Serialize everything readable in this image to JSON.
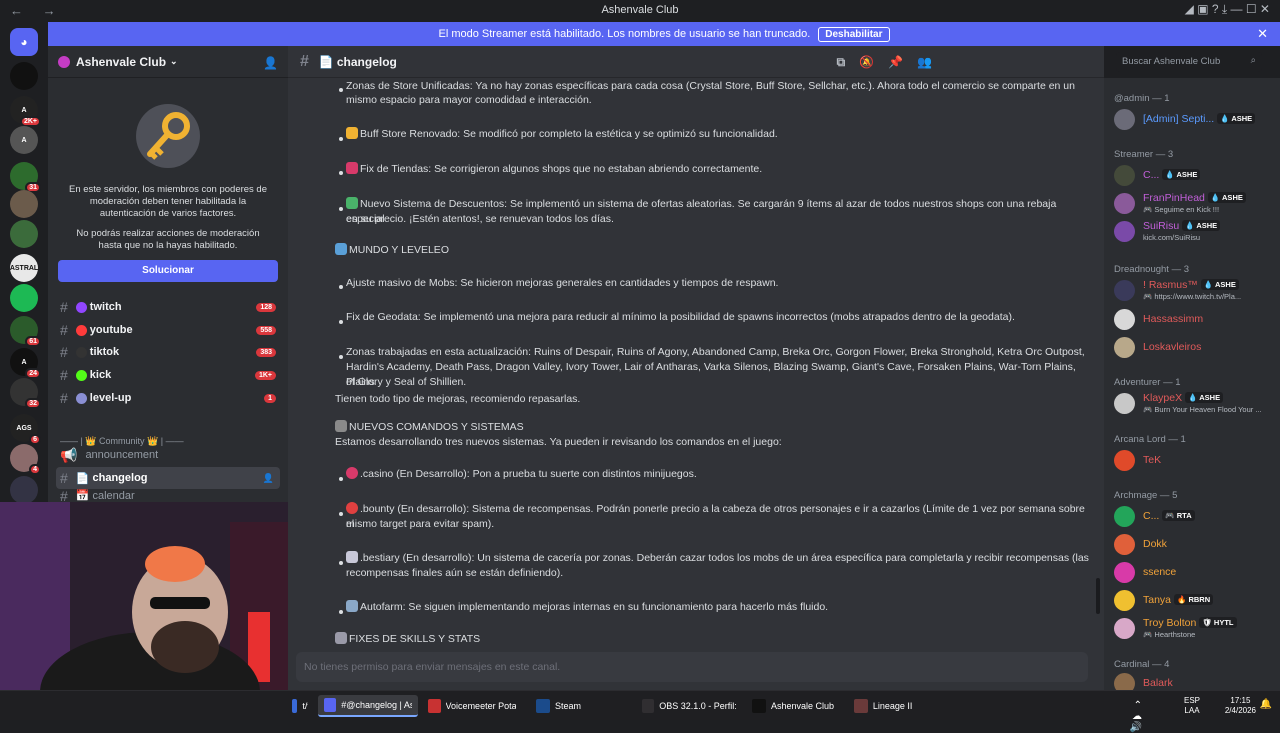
{
  "window": {
    "title": "Ashenvale Club",
    "nav_arrows": "← →",
    "controls": "◢ ▣ ? ⤓ — ☐ ✕"
  },
  "banner": {
    "text": "El modo Streamer está habilitado. Los nombres de usuario se han truncado.",
    "button": "Deshabilitar",
    "close": "✕"
  },
  "guilds": [
    {
      "label": "",
      "color": "#5865f2",
      "badge": ""
    },
    {
      "label": "",
      "color": "#111111",
      "badge": ""
    },
    {
      "label": "A",
      "color": "#222222",
      "badge": "2K+"
    },
    {
      "label": "A",
      "color": "#555555",
      "badge": ""
    },
    {
      "label": "",
      "color": "#2d6b2d",
      "badge": "31"
    },
    {
      "label": "",
      "color": "#6b5b4b",
      "badge": ""
    },
    {
      "label": "",
      "color": "#3b6b3b",
      "badge": ""
    },
    {
      "label": "ASTRAL",
      "color": "#e8e8e8",
      "badge": ""
    },
    {
      "label": "",
      "color": "#1db954",
      "badge": ""
    },
    {
      "label": "",
      "color": "#2b5b2b",
      "badge": "61"
    },
    {
      "label": "A",
      "color": "#111111",
      "badge": "24"
    },
    {
      "label": "",
      "color": "#333333",
      "badge": "32"
    },
    {
      "label": "AGS",
      "color": "#222222",
      "badge": "6"
    },
    {
      "label": "",
      "color": "#8b6b6b",
      "badge": "4"
    },
    {
      "label": "",
      "color": "#333344",
      "badge": ""
    }
  ],
  "sidebar": {
    "server_name": "Ashenvale Club",
    "mod_text_1": "En este servidor, los miembros con poderes de moderación deben tener habilitada la autenticación de varios factores.",
    "mod_text_2": "No podrás realizar acciones de moderación hasta que no la hayas habilitado.",
    "solve_button": "Solucionar",
    "channels": [
      {
        "name": "twitch",
        "dot": "#9146ff",
        "badge": "128"
      },
      {
        "name": "youtube",
        "dot": "#ff3b3b",
        "badge": "558"
      },
      {
        "name": "tiktok",
        "dot": "#333333",
        "badge": "383"
      },
      {
        "name": "kick",
        "dot": "#53fc18",
        "badge": "1K+"
      },
      {
        "name": "level-up",
        "dot": "#8a8fd4",
        "badge": "1"
      }
    ],
    "category": "—— | 👑 Community 👑 | ——",
    "announcement": "announcement",
    "changelog": "changelog",
    "calendar": "calendar"
  },
  "channel_header": {
    "name": "changelog",
    "search_placeholder": "Buscar Ashenvale Club"
  },
  "messages": {
    "m1": "Zonas de Store Unificadas: Ya no hay zonas específicas para cada cosa (Crystal Store, Buff Store, Sellchar, etc.). Ahora todo el comercio se comparte en un",
    "m1b": "mismo espacio para mayor comodidad e interacción.",
    "m2": "Buff Store Renovado: Se modificó por completo la estética y se optimizó su funcionalidad.",
    "m3": "Fix de Tiendas: Se corrigieron algunos shops que no estaban abriendo correctamente.",
    "m4": "Nuevo Sistema de Descuentos: Se implementó un sistema de ofertas aleatorias. Se cargarán 9 ítems al azar de todos nuestros shops con una rebaja especial",
    "m4b": "en su precio. ¡Estén atentos!, se renuevan todos los días.",
    "h1": "MUNDO Y LEVELEO",
    "m5": "Ajuste masivo de Mobs: Se hicieron mejoras generales en cantidades y tiempos de respawn.",
    "m6": "Fix de Geodata: Se implementó una mejora para reducir al mínimo la posibilidad de spawns incorrectos (mobs atrapados dentro de la geodata).",
    "m7": "Zonas trabajadas en esta actualización: Ruins of Despair, Ruins of Agony, Abandoned Camp, Breka Orc, Gorgon Flower, Breka Stronghold, Ketra Orc Outpost,",
    "m7b": "Hardin's Academy, Death Pass, Dragon Valley, Ivory Tower, Lair of Antharas, Varka Silenos, Blazing Swamp, Giant's Cave, Forsaken Plains, War-Torn Plains, Plains",
    "m7c": "of Glory y Seal of Shillien.",
    "m8": "Tienen todo tipo de mejoras, recomiendo repasarlas.",
    "h2": "NUEVOS COMANDOS Y SISTEMAS",
    "m9": "Estamos desarrollando tres nuevos sistemas. Ya pueden ir revisando los comandos en el juego:",
    "m10": ".casino (En Desarrollo): Pon a prueba tu suerte con distintos minijuegos.",
    "m11": ".bounty (En desarrollo): Sistema de recompensas. Podrán ponerle precio a la cabeza de otros personajes e ir a cazarlos (Límite de 1 vez por semana sobre el",
    "m11b": "mismo target para evitar spam).",
    "m12": ".bestiary (En desarrollo): Un sistema de cacería por zonas. Deberán cazar todos los mobs de un área específica para completarla y recibir recompensas (las",
    "m12b": "recompensas finales aún se están definiendo).",
    "m13": "Autofarm: Se siguen implementando mejoras internas en su funcionamiento para hacerlo más fluido.",
    "h3": "FIXES DE SKILLS Y STATS",
    "input_placeholder": "No tienes permiso para enviar mensajes en este canal."
  },
  "members": {
    "groups": [
      {
        "label": "@admin — 1"
      },
      {
        "label": "Streamer — 3"
      },
      {
        "label": "Dreadnought — 3"
      },
      {
        "label": "Adventurer — 1"
      },
      {
        "label": "Arcana Lord — 1"
      },
      {
        "label": "Archmage — 5"
      },
      {
        "label": "Cardinal — 4"
      }
    ],
    "list": [
      {
        "name": "[Admin] Septi...",
        "color": "#5b9bff",
        "tag": "💧 ASHE",
        "status": "",
        "av": "#6b6b78"
      },
      {
        "name": "C...",
        "color": "#c15fd8",
        "tag": "💧 ASHE",
        "status": "",
        "av": "#444a3a"
      },
      {
        "name": "FranPinHead",
        "color": "#c15fd8",
        "tag": "💧 ASHE",
        "status": "🎮 Seguime en Kick !!!",
        "av": "#8a5a9a"
      },
      {
        "name": "SuiRisu",
        "color": "#c15fd8",
        "tag": "💧 ASHE",
        "status": "kick.com/SuiRisu",
        "av": "#7a4aa8"
      },
      {
        "name": "! Rasmus™",
        "color": "#e05a5a",
        "tag": "💧 ASHE",
        "status": "🎮 https://www.twitch.tv/Pla...",
        "av": "#3a3a5a"
      },
      {
        "name": "Hassassimm",
        "color": "#e05a5a",
        "tag": "",
        "status": "",
        "av": "#d8d8d8"
      },
      {
        "name": "Loskavleiros",
        "color": "#e05a5a",
        "tag": "",
        "status": "",
        "av": "#b8a88a"
      },
      {
        "name": "KlaypeX",
        "color": "#e05a5a",
        "tag": "💧 ASHE",
        "status": "🎮 Burn Your Heaven Flood Your ...",
        "av": "#c8c8c8"
      },
      {
        "name": "TeK",
        "color": "#e05a5a",
        "tag": "",
        "status": "",
        "av": "#e04a2a"
      },
      {
        "name": "C...",
        "color": "#f0a23a",
        "tag": "🎮 RTA",
        "status": "",
        "av": "#23a55a"
      },
      {
        "name": "Dokk",
        "color": "#f0a23a",
        "tag": "",
        "status": "",
        "av": "#e0603a"
      },
      {
        "name": "ssence",
        "color": "#f0a23a",
        "tag": "",
        "status": "",
        "av": "#d83aa8"
      },
      {
        "name": "Tanya",
        "color": "#f0a23a",
        "tag": "🔥 RBRN",
        "status": "",
        "av": "#f0c030"
      },
      {
        "name": "Troy Bolton",
        "color": "#f0a23a",
        "tag": "🛡 HYTL",
        "status": "🎮 Hearthstone",
        "av": "#d8a8c8"
      },
      {
        "name": "Balark",
        "color": "#e05a5a",
        "tag": "",
        "status": "",
        "av": "#8a6a4a"
      }
    ]
  },
  "taskbar": {
    "items": [
      {
        "label": "t/f...",
        "color": "#3a6ad8"
      },
      {
        "label": "#@changelog | As...",
        "color": "#5865f2"
      },
      {
        "label": "Voicemeeter Potato",
        "color": "#c83232"
      },
      {
        "label": "Steam",
        "color": "#1b4b8b"
      },
      {
        "label": "OBS 32.1.0 - Perfil: ...",
        "color": "#302e31"
      },
      {
        "label": "Ashenvale Club",
        "color": "#111111"
      },
      {
        "label": "Lineage II",
        "color": "#6a3a3a"
      }
    ],
    "lang": "ESP",
    "lang2": "LAA",
    "time": "17:15",
    "date": "2/4/2026"
  }
}
